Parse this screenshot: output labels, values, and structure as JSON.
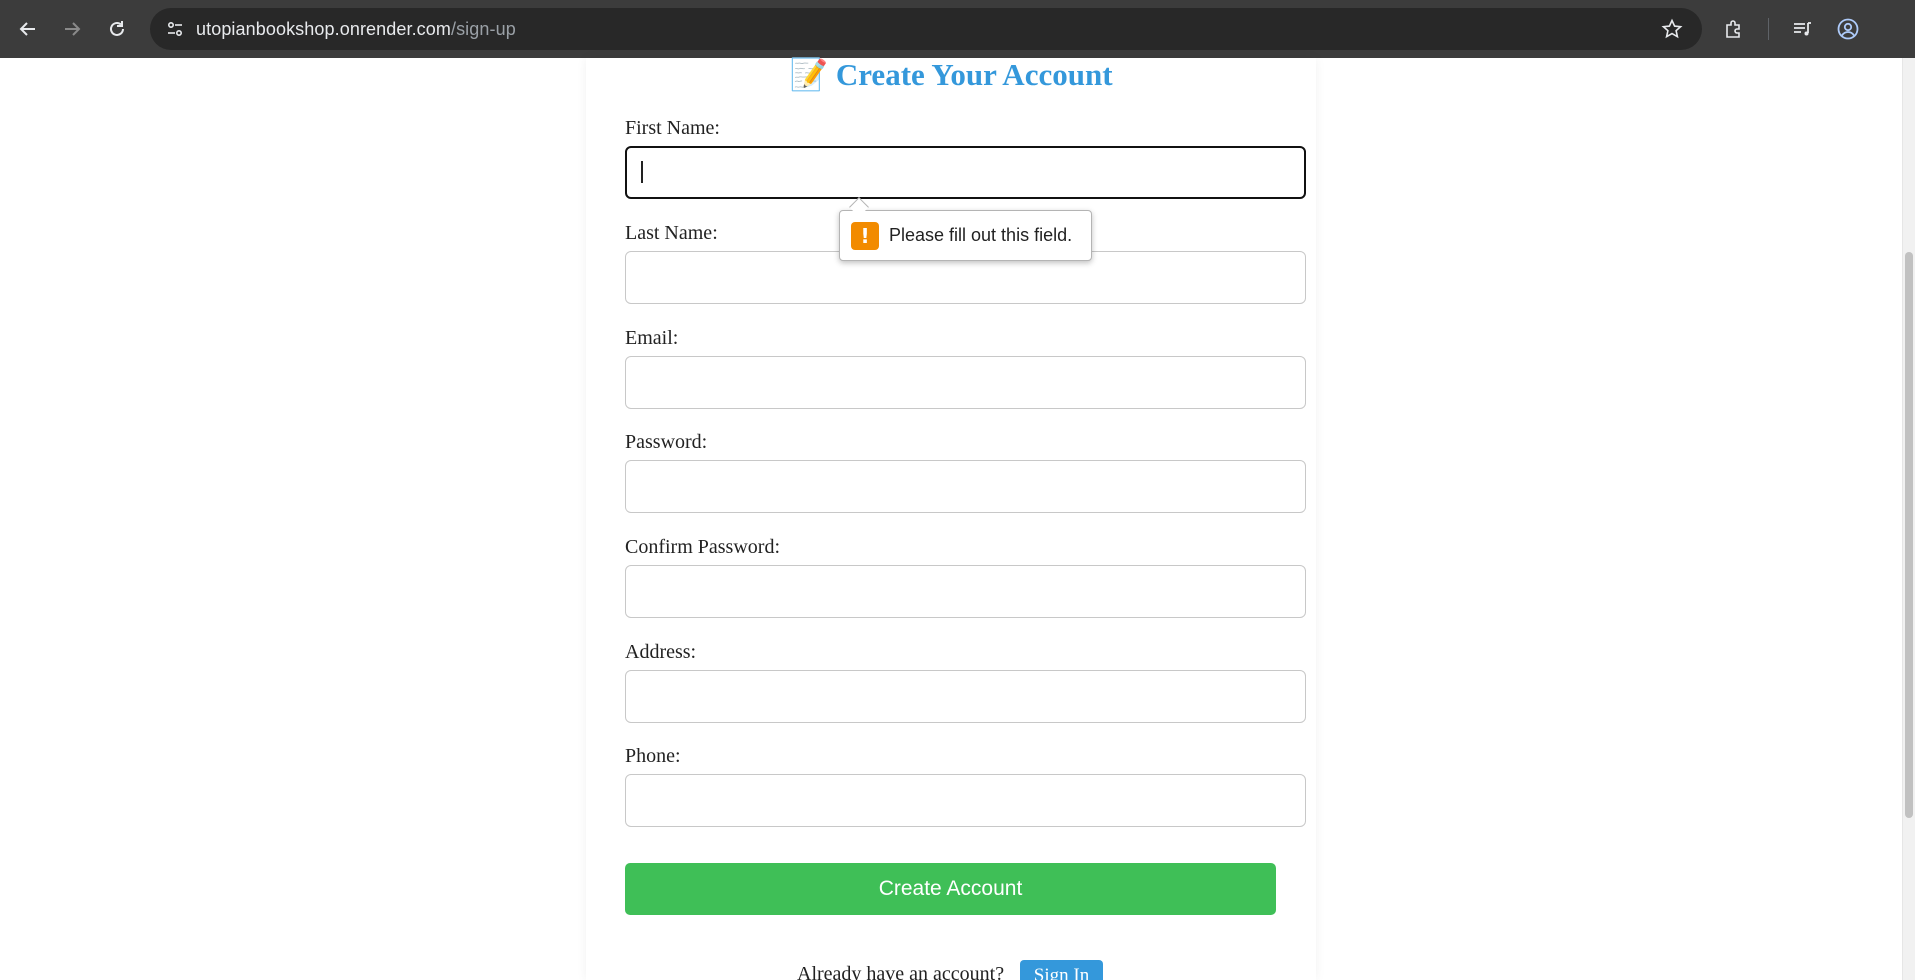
{
  "browser": {
    "url_host": "utopianbookshop.onrender.com",
    "url_path": "/sign-up"
  },
  "page": {
    "title_emoji": "📝",
    "title": "Create Your Account",
    "fields": [
      {
        "label": "First Name:",
        "value": ""
      },
      {
        "label": "Last Name:",
        "value": ""
      },
      {
        "label": "Email:",
        "value": ""
      },
      {
        "label": "Password:",
        "value": ""
      },
      {
        "label": "Confirm Password:",
        "value": ""
      },
      {
        "label": "Address:",
        "value": ""
      },
      {
        "label": "Phone:",
        "value": ""
      }
    ],
    "validation_message": "Please fill out this field.",
    "submit_label": "Create Account",
    "signin_prompt": "Already have an account?",
    "signin_label": "Sign In"
  },
  "colors": {
    "title": "#3498db",
    "submit": "#3fbf57",
    "signin": "#3498db",
    "warning": "#f28b00"
  },
  "icons": [
    "back-arrow-icon",
    "forward-arrow-icon",
    "reload-icon",
    "site-info-icon",
    "bookmark-star-icon",
    "extensions-icon",
    "media-controls-icon",
    "profile-icon",
    "warning-icon"
  ]
}
